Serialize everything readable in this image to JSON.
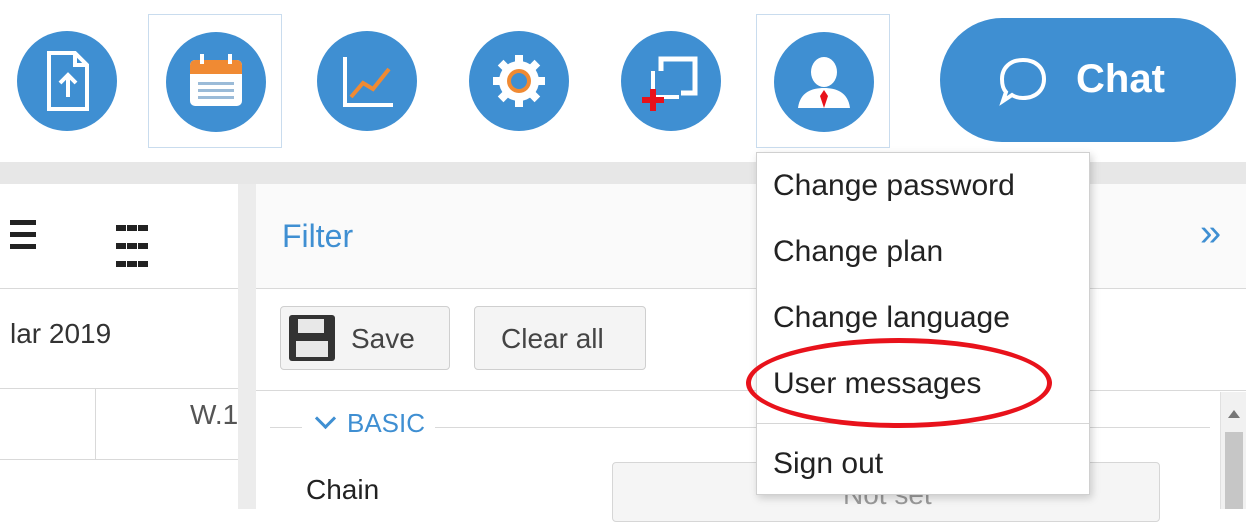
{
  "toolbar": {
    "buttons": [
      {
        "name": "upload-document-button",
        "icon": "upload-document-icon"
      },
      {
        "name": "calendar-button",
        "icon": "calendar-icon",
        "active": true
      },
      {
        "name": "chart-button",
        "icon": "line-chart-icon"
      },
      {
        "name": "settings-button",
        "icon": "gear-icon"
      },
      {
        "name": "add-window-button",
        "icon": "add-window-icon"
      },
      {
        "name": "user-button",
        "icon": "user-icon",
        "active": true
      }
    ],
    "chat_label": "Chat",
    "chat_icon": "speech-bubble-icon"
  },
  "colors": {
    "accent": "#3f8fd2",
    "highlight": "#e8121b",
    "add": "#e8121b"
  },
  "left_panel": {
    "month": "lar 2019",
    "week": "W.1",
    "view_icons": [
      "list-view-icon",
      "grid-view-icon"
    ]
  },
  "filter": {
    "title": "Filter",
    "expand": "»",
    "save_label": "Save",
    "clear_label": "Clear all",
    "section_label": "BASIC",
    "field_label": "Chain",
    "field_value": "Not set"
  },
  "user_menu": {
    "items": [
      "Change password",
      "Change plan",
      "Change language",
      "User messages",
      "Sign out"
    ],
    "highlighted": "User messages"
  }
}
